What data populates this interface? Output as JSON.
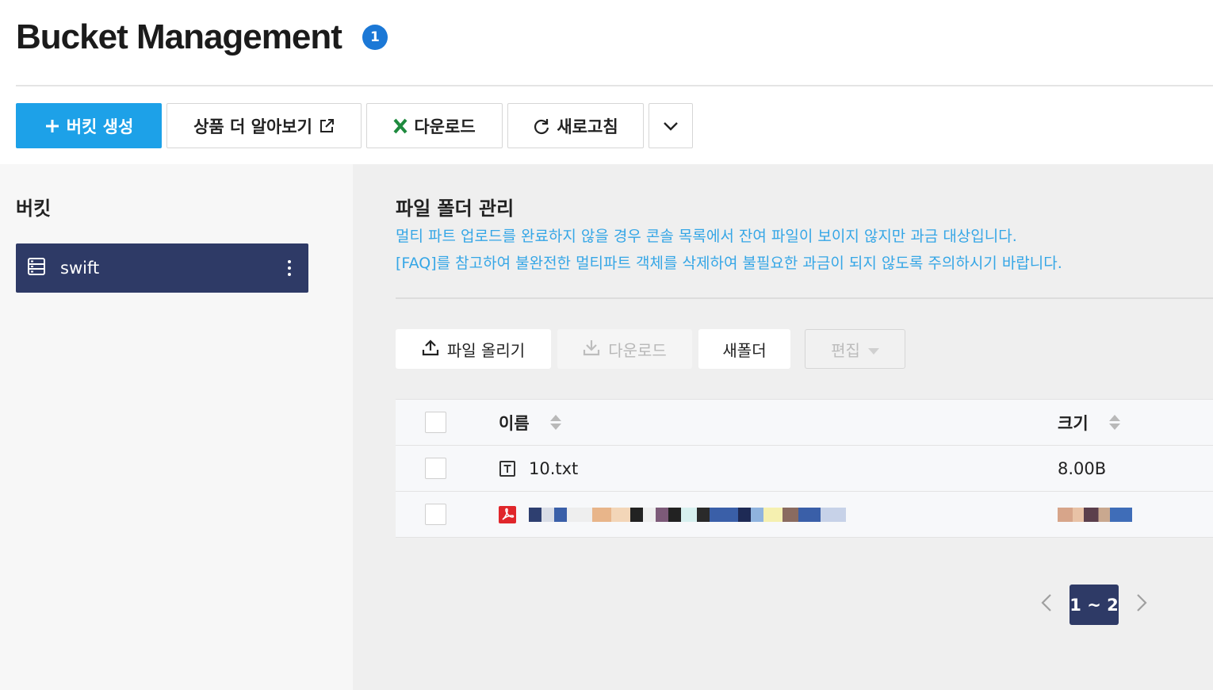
{
  "header": {
    "title": "Bucket Management",
    "badge": "1"
  },
  "toolbar": {
    "create_label": "버킷 생성",
    "learn_label": "상품 더 알아보기",
    "download_label": "다운로드",
    "refresh_label": "새로고침"
  },
  "left": {
    "title": "버킷",
    "buckets": [
      {
        "name": "swift"
      }
    ]
  },
  "right": {
    "title": "파일 폴더 관리",
    "notice_lines": [
      "멀티 파트 업로드를 완료하지 않을 경우 콘솔 목록에서 잔여 파일이 보이지 않지만 과금 대상입니다.",
      "[FAQ]를 참고하여 불완전한 멀티파트 객체를 삭제하여 불필요한 과금이 되지 않도록 주의하시기 바랍니다."
    ],
    "actions": {
      "upload_label": "파일 올리기",
      "download_label": "다운로드",
      "new_folder_label": "새폴더",
      "edit_label": "편집"
    },
    "table": {
      "columns": {
        "name": "이름",
        "size": "크기"
      },
      "rows": [
        {
          "type": "text",
          "name": "10.txt",
          "size": "8.00B"
        },
        {
          "type": "pdf",
          "name": "",
          "size": ""
        }
      ]
    },
    "pagination": {
      "current": "1 ~ 2"
    }
  },
  "colors": {
    "primary": "#1da1e8",
    "navy": "#2e3a66",
    "notice": "#35a6e6",
    "badge": "#1b78d6",
    "excel_green": "#1e8a3e",
    "pdf_red": "#e0262b"
  }
}
